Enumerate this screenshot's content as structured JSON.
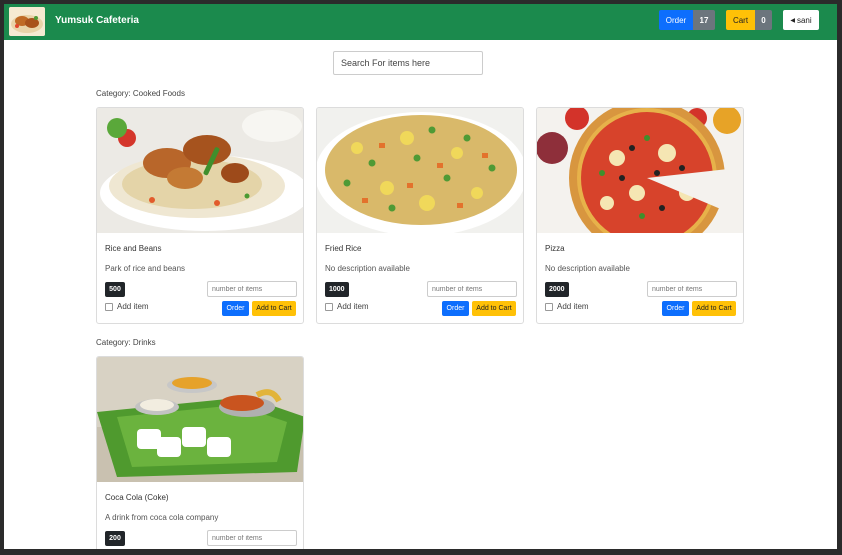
{
  "app": {
    "brand": "Yumsuk Cafeteria"
  },
  "header": {
    "order_label": "Order",
    "order_count": "17",
    "cart_label": "Cart",
    "cart_count": "0",
    "user_label": "sani",
    "user_icon": "chevron-left-icon"
  },
  "search": {
    "placeholder": "Search For items here"
  },
  "colors": {
    "navbar": "#1b8a4d",
    "primary": "#0d6efd",
    "warning": "#ffc107",
    "dark": "#212529",
    "secondary": "#6c757d"
  },
  "categories": [
    {
      "label": "Category: Cooked Foods",
      "items": [
        {
          "name": "Rice and Beans",
          "description": "Park of rice and beans",
          "price": "500",
          "qty_placeholder": "number of items",
          "add_label": "Add item",
          "order_label": "Order",
          "cart_label": "Add to Cart"
        },
        {
          "name": "Fried Rice",
          "description": "No description available",
          "price": "1000",
          "qty_placeholder": "number of items",
          "add_label": "Add item",
          "order_label": "Order",
          "cart_label": "Add to Cart"
        },
        {
          "name": "Pizza",
          "description": "No description available",
          "price": "2000",
          "qty_placeholder": "number of items",
          "add_label": "Add item",
          "order_label": "Order",
          "cart_label": "Add to Cart"
        }
      ]
    },
    {
      "label": "Category: Drinks",
      "items": [
        {
          "name": "Coca Cola (Coke)",
          "description": "A drink from coca cola company",
          "price": "200",
          "qty_placeholder": "number of items"
        }
      ]
    }
  ]
}
